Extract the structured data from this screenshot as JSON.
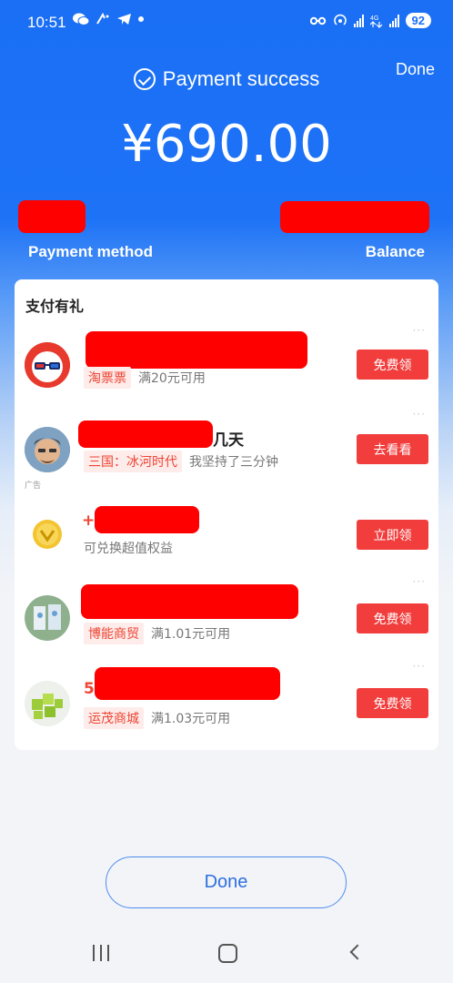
{
  "status_bar": {
    "time": "10:51",
    "battery": "92",
    "icons_left": [
      "chat-icon",
      "wifi-call-icon",
      "telegram-icon",
      "dot-icon"
    ],
    "icons_right": [
      "key-icon",
      "hotspot-icon",
      "signal-icon",
      "signal-4g-icon",
      "signal-icon"
    ]
  },
  "header": {
    "done_label": "Done",
    "title": "Payment success",
    "amount": "¥690.00"
  },
  "info": {
    "payment_method_label": "Payment method",
    "balance_label": "Balance"
  },
  "promo_card": {
    "title": "支付有礼",
    "items": [
      {
        "title_suffix": "",
        "tag": "淘票票",
        "desc": "满20元可用",
        "button": "免费领",
        "ad": ""
      },
      {
        "title_suffix": "几天",
        "tag": "三国：冰河时代",
        "desc": "我坚持了三分钟",
        "button": "去看看",
        "ad": "广告"
      },
      {
        "title_suffix": "",
        "tag": "",
        "desc": "可兑换超值权益",
        "button": "立即领",
        "ad": ""
      },
      {
        "title_suffix": "",
        "tag": "博能商贸",
        "desc": "满1.01元可用",
        "button": "免费领",
        "ad": ""
      },
      {
        "title_suffix": "",
        "tag": "运茂商城",
        "desc": "满1.03元可用",
        "button": "免费领",
        "ad": ""
      }
    ],
    "more_label": "···"
  },
  "footer": {
    "done_label": "Done"
  },
  "colors": {
    "brand_blue": "#1a6ff5",
    "button_red": "#f23d3d",
    "tag_red": "#ee4433",
    "redaction": "#ff0000"
  }
}
